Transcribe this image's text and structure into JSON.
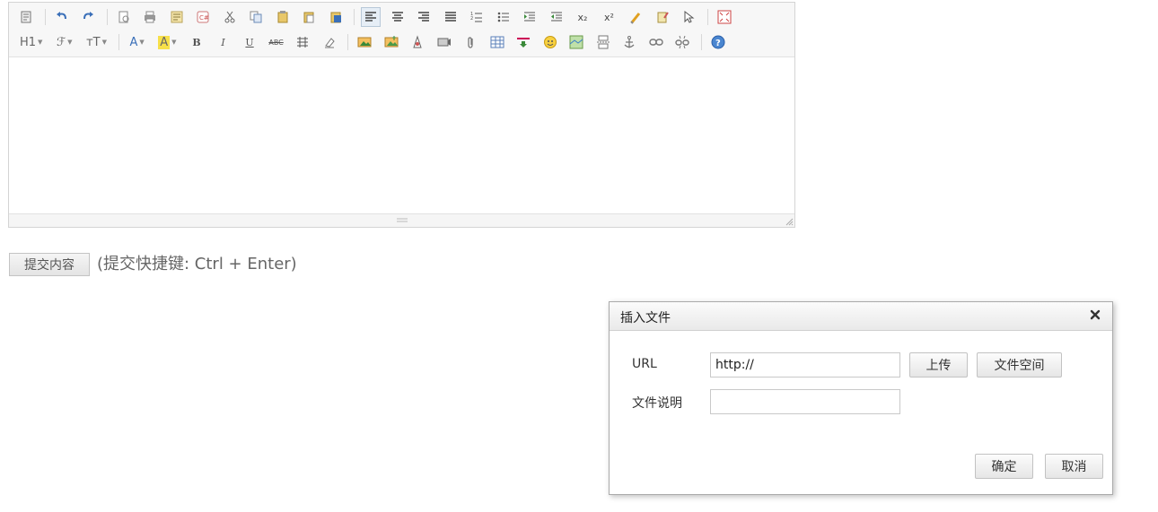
{
  "editor": {
    "toolbar_row1": [
      {
        "icon": "source-code-icon"
      },
      {
        "sep": true
      },
      {
        "icon": "undo-icon"
      },
      {
        "icon": "redo-icon"
      },
      {
        "sep": true
      },
      {
        "icon": "preview-icon"
      },
      {
        "icon": "print-icon"
      },
      {
        "icon": "template-icon"
      },
      {
        "icon": "code-icon"
      },
      {
        "icon": "cut-icon"
      },
      {
        "icon": "copy-icon"
      },
      {
        "icon": "paste-icon"
      },
      {
        "icon": "paste-text-icon"
      },
      {
        "icon": "paste-word-icon"
      },
      {
        "sep": true
      },
      {
        "icon": "align-left-icon",
        "active": true
      },
      {
        "icon": "align-center-icon"
      },
      {
        "icon": "align-right-icon"
      },
      {
        "icon": "align-justify-icon"
      },
      {
        "icon": "ordered-list-icon"
      },
      {
        "icon": "unordered-list-icon"
      },
      {
        "icon": "indent-icon"
      },
      {
        "icon": "outdent-icon"
      },
      {
        "icon": "subscript-icon",
        "text": "x₂"
      },
      {
        "icon": "superscript-icon",
        "text": "x²"
      },
      {
        "icon": "clear-format-icon"
      },
      {
        "icon": "quick-format-icon"
      },
      {
        "icon": "select-all-icon"
      },
      {
        "sep": true
      },
      {
        "icon": "fullscreen-icon"
      }
    ],
    "toolbar_row2": [
      {
        "icon": "heading-icon",
        "text": "H1",
        "caret": true
      },
      {
        "icon": "font-family-icon",
        "text": "ℱ",
        "caret": true
      },
      {
        "icon": "font-size-icon",
        "text": "ᴛT",
        "caret": true
      },
      {
        "sep": true
      },
      {
        "icon": "font-color-icon",
        "text": "A",
        "caret": true
      },
      {
        "icon": "highlight-color-icon",
        "text": "A",
        "caret": true
      },
      {
        "icon": "bold-icon",
        "text": "B"
      },
      {
        "icon": "italic-icon",
        "text": "I"
      },
      {
        "icon": "underline-icon",
        "text": "U"
      },
      {
        "icon": "strikethrough-icon",
        "text": "ABC"
      },
      {
        "icon": "line-height-icon"
      },
      {
        "icon": "remove-format-icon"
      },
      {
        "sep": true
      },
      {
        "icon": "image-icon"
      },
      {
        "icon": "multi-image-icon"
      },
      {
        "icon": "flash-icon"
      },
      {
        "icon": "media-icon"
      },
      {
        "icon": "attachment-icon"
      },
      {
        "icon": "table-icon"
      },
      {
        "icon": "insert-hr-icon"
      },
      {
        "icon": "emoticon-icon"
      },
      {
        "icon": "map-icon"
      },
      {
        "icon": "page-break-icon"
      },
      {
        "icon": "anchor-icon"
      },
      {
        "icon": "link-icon"
      },
      {
        "icon": "unlink-icon"
      },
      {
        "sep": true
      },
      {
        "icon": "help-icon"
      }
    ]
  },
  "submit": {
    "button_label": "提交内容",
    "hint": "(提交快捷键: Ctrl + Enter)"
  },
  "dialog": {
    "title": "插入文件",
    "url_label": "URL",
    "url_value": "http://",
    "desc_label": "文件说明",
    "desc_value": "",
    "upload_label": "上传",
    "file_space_label": "文件空间",
    "ok_label": "确定",
    "cancel_label": "取消"
  }
}
